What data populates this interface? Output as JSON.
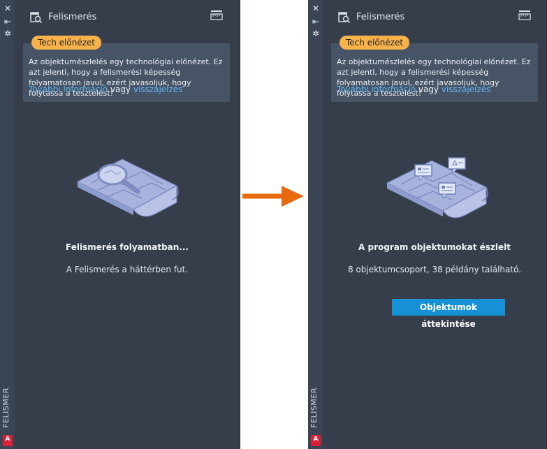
{
  "palettes": [
    {
      "side_label": "FELISMER",
      "logo_letter": "A",
      "controls": {
        "close": "✕",
        "pin": "⇤",
        "settings": "✲"
      },
      "header": {
        "title": "Felismerés"
      },
      "preview": {
        "badge": "Tech előnézet",
        "text": "Az objektumészlelés egy technológiai előnézet. Ez azt jelenti, hogy a felismerési képesség folyamatosan javul, ezért javasoljuk, hogy folytassa a tesztelést!",
        "link_more": "További információ",
        "connector": "vagy",
        "link_feedback": "visszajelzés"
      },
      "status": {
        "title": "Felismerés folyamatban...",
        "subtitle": "A Felismerés a háttérben fut."
      }
    },
    {
      "side_label": "FELISMER",
      "logo_letter": "A",
      "controls": {
        "close": "✕",
        "pin": "⇤",
        "settings": "✲"
      },
      "header": {
        "title": "Felismerés"
      },
      "preview": {
        "badge": "Tech előnézet",
        "text": "Az objektumészlelés egy technológiai előnézet. Ez azt jelenti, hogy a felismerési képesség folyamatosan javul, ezért javasoljuk, hogy folytassa a tesztelést!",
        "link_more": "További információ",
        "connector": "vagy",
        "link_feedback": "visszajelzés"
      },
      "status": {
        "title": "A program objektumokat észlelt",
        "subtitle": "8 objektumcsoport, 38 példány található."
      },
      "action_button": "Objektumok áttekintése"
    }
  ],
  "colors": {
    "panel_bg": "#363e4b",
    "strip_bg": "#3b4453",
    "badge_bg": "#f8b249",
    "link": "#5fb4f0",
    "button": "#1791d6",
    "arrow": "#e8690e"
  },
  "icons": {
    "header_icon": "scan-document-icon",
    "header_right": "ruler-icon",
    "illustration_left": "blueprint-magnifier-illustration",
    "illustration_right": "blueprint-markers-illustration",
    "transition": "right-arrow-icon"
  }
}
